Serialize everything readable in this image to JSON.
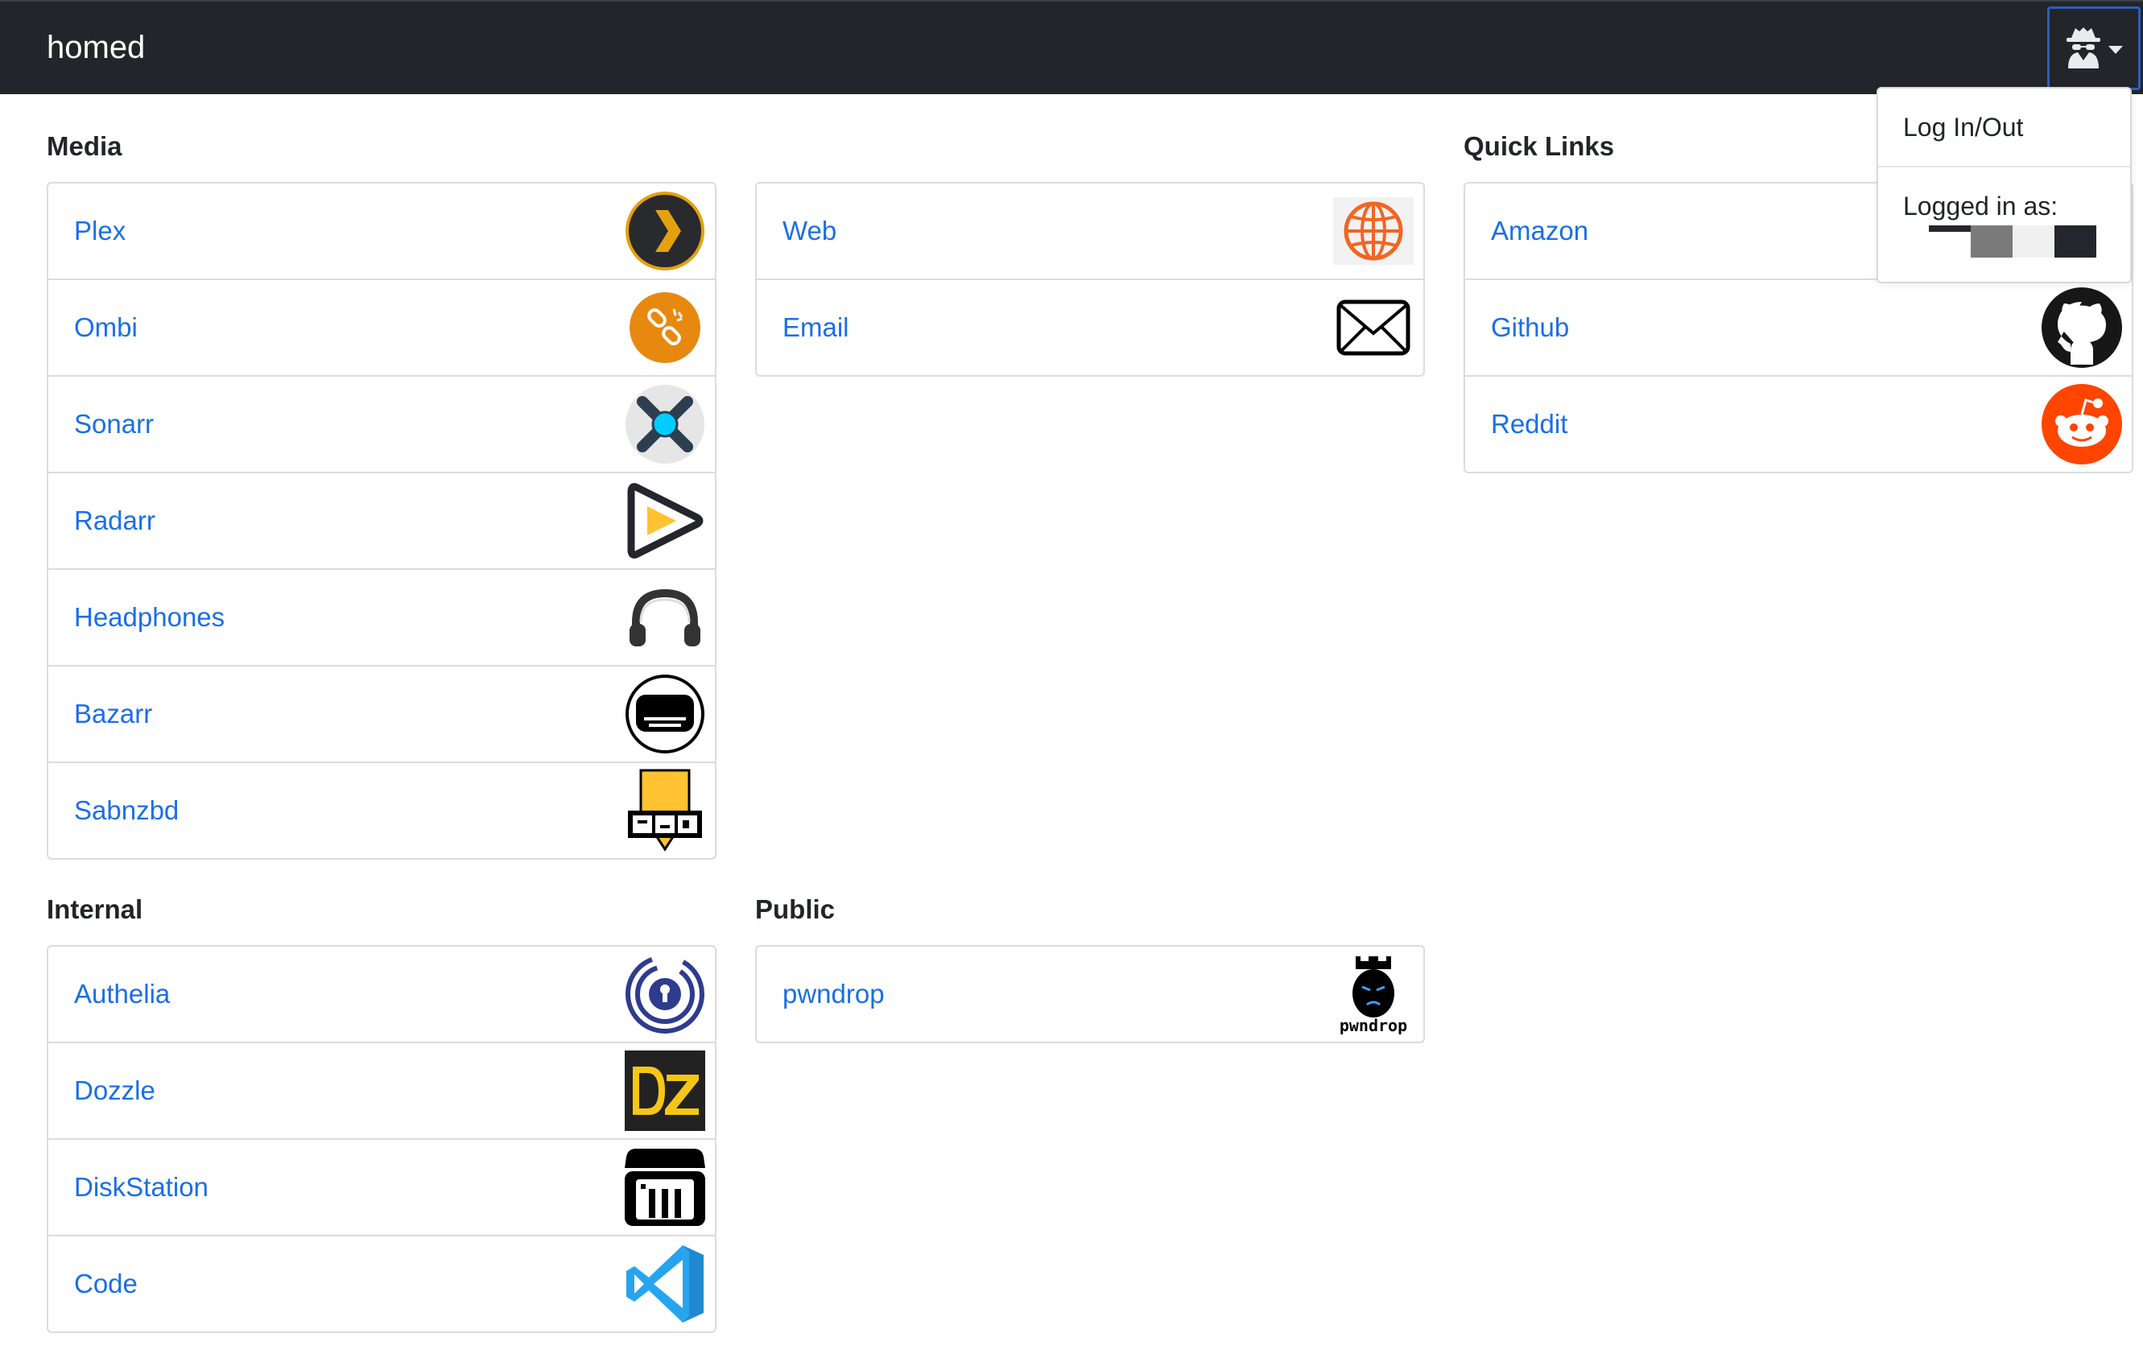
{
  "navbar": {
    "brand": "homed"
  },
  "user_menu": {
    "icon": "incognito-user-icon",
    "items": [
      {
        "label": "Log In/Out"
      },
      {
        "label": "Logged in as:"
      }
    ]
  },
  "sections": {
    "media": {
      "title": "Media",
      "items": [
        {
          "label": "Plex",
          "icon": "plex-icon"
        },
        {
          "label": "Ombi",
          "icon": "ombi-icon"
        },
        {
          "label": "Sonarr",
          "icon": "sonarr-icon"
        },
        {
          "label": "Radarr",
          "icon": "radarr-icon"
        },
        {
          "label": "Headphones",
          "icon": "headphones-icon"
        },
        {
          "label": "Bazarr",
          "icon": "bazarr-icon"
        },
        {
          "label": "Sabnzbd",
          "icon": "sabnzbd-icon"
        }
      ]
    },
    "general": {
      "title": "",
      "items": [
        {
          "label": "Web",
          "icon": "globe-icon"
        },
        {
          "label": "Email",
          "icon": "envelope-icon"
        }
      ]
    },
    "quick_links": {
      "title": "Quick Links",
      "items": [
        {
          "label": "Amazon",
          "icon": "amazon-icon"
        },
        {
          "label": "Github",
          "icon": "github-icon"
        },
        {
          "label": "Reddit",
          "icon": "reddit-icon"
        }
      ]
    },
    "internal": {
      "title": "Internal",
      "items": [
        {
          "label": "Authelia",
          "icon": "authelia-icon"
        },
        {
          "label": "Dozzle",
          "icon": "dozzle-icon"
        },
        {
          "label": "DiskStation",
          "icon": "diskstation-icon"
        },
        {
          "label": "Code",
          "icon": "vscode-icon"
        }
      ]
    },
    "public": {
      "title": "Public",
      "items": [
        {
          "label": "pwndrop",
          "icon": "pwndrop-icon",
          "icon_text": "pwndrop"
        }
      ]
    }
  },
  "colors": {
    "navbar_bg": "#22262b",
    "link": "#1a6fe6",
    "plex_orange": "#e5a00d",
    "ombi_orange": "#e8890f",
    "reddit_red": "#ff4500",
    "globe_orange": "#f26522",
    "vscode_blue": "#1f8ad2",
    "authelia_blue": "#2e3b8f",
    "dozzle_yellow": "#f5c518"
  }
}
